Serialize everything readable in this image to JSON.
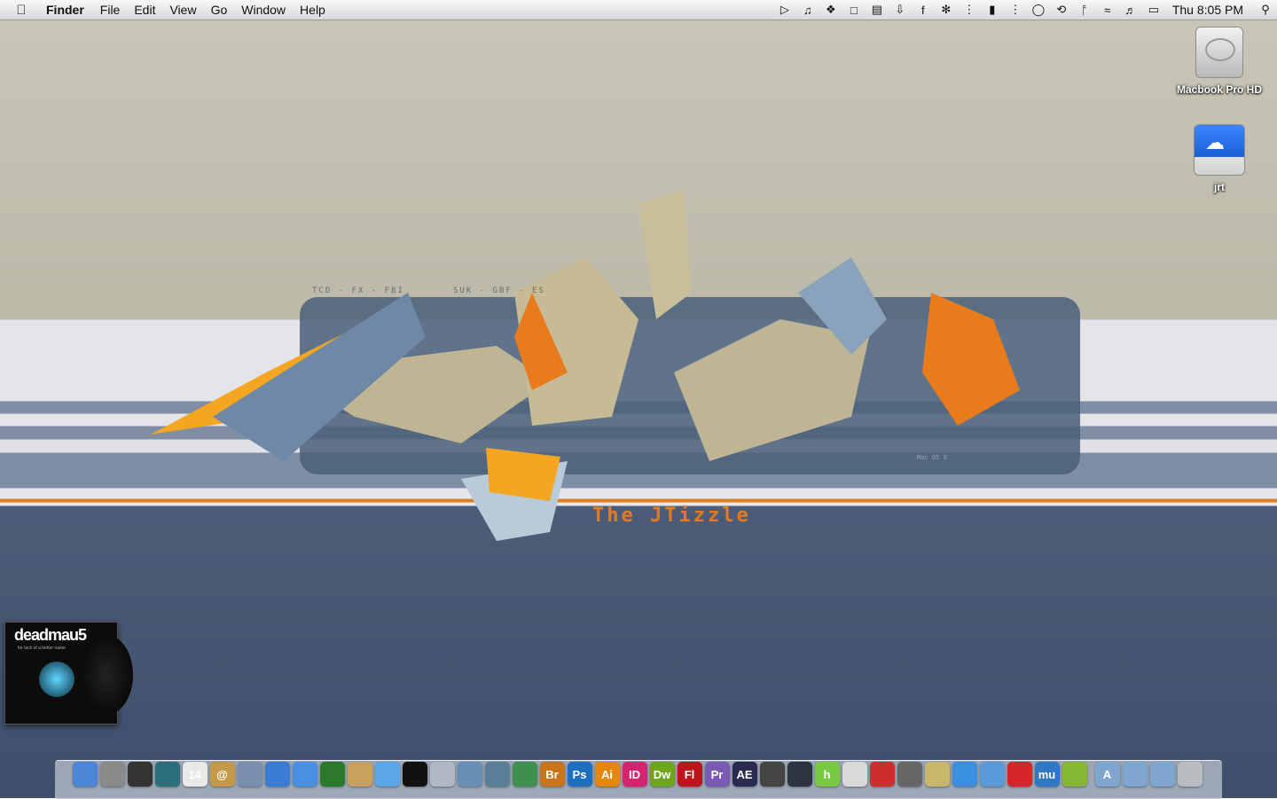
{
  "menubar": {
    "apple": "",
    "app_name": "Finder",
    "menus": [
      "File",
      "Edit",
      "View",
      "Go",
      "Window",
      "Help"
    ],
    "status_icons": [
      "play-icon",
      "music-note-icon",
      "bird-icon",
      "screen-capture-icon",
      "notes-icon",
      "download-icon",
      "facebook-icon",
      "fan-icon",
      "temp-icon",
      "memory-icon",
      "cpu-icon",
      "chat-icon",
      "time-machine-icon",
      "bluetooth-icon",
      "wifi-icon",
      "volume-icon",
      "battery-icon"
    ],
    "clock": "Thu 8:05 PM"
  },
  "desktop_icons": [
    {
      "label": "Macbook Pro HD",
      "icon": "hard-drive-icon"
    },
    {
      "label": "jrt",
      "icon": "icloud-drive-icon"
    }
  ],
  "wallpaper": {
    "tag_left": "TCD - FX - FBI",
    "tag_right": "SUK - GBF - ES",
    "os_label": "Mac OS X",
    "signature": "The JTizzle"
  },
  "album": {
    "artist": "deadmau5",
    "subtitle": "for lack of a better name"
  },
  "dock": {
    "apps": [
      {
        "name": "finder",
        "text": "",
        "color": "#4b86d8"
      },
      {
        "name": "system-preferences",
        "text": "",
        "color": "#8a8a8a"
      },
      {
        "name": "dashboard",
        "text": "",
        "color": "#333333"
      },
      {
        "name": "time-machine",
        "text": "",
        "color": "#2c6e7a"
      },
      {
        "name": "calendar",
        "text": "14",
        "color": "#e9e9e9"
      },
      {
        "name": "address-book",
        "text": "@",
        "color": "#c49a4a"
      },
      {
        "name": "preview",
        "text": "",
        "color": "#7a8fb0"
      },
      {
        "name": "safari",
        "text": "",
        "color": "#3a7bd5"
      },
      {
        "name": "ichat",
        "text": "",
        "color": "#4a90e2"
      },
      {
        "name": "limewire",
        "text": "",
        "color": "#2b7a2b"
      },
      {
        "name": "photo-app",
        "text": "",
        "color": "#c8a060"
      },
      {
        "name": "itunes",
        "text": "",
        "color": "#5aa6e6"
      },
      {
        "name": "dvd-player",
        "text": "",
        "color": "#111111"
      },
      {
        "name": "satellite-app",
        "text": "",
        "color": "#b0b8c4"
      },
      {
        "name": "iphoto",
        "text": "",
        "color": "#6a8fb6"
      },
      {
        "name": "paint-app",
        "text": "",
        "color": "#5a7f9a"
      },
      {
        "name": "chart-app",
        "text": "",
        "color": "#3f8f4f"
      },
      {
        "name": "bridge",
        "text": "Br",
        "color": "#c8741c"
      },
      {
        "name": "photoshop",
        "text": "Ps",
        "color": "#1f6fc0"
      },
      {
        "name": "illustrator",
        "text": "Ai",
        "color": "#e5860d"
      },
      {
        "name": "indesign",
        "text": "ID",
        "color": "#d6236d"
      },
      {
        "name": "dreamweaver",
        "text": "Dw",
        "color": "#6da51c"
      },
      {
        "name": "flash",
        "text": "Fl",
        "color": "#c0141c"
      },
      {
        "name": "premiere",
        "text": "Pr",
        "color": "#7a5ab5"
      },
      {
        "name": "after-effects",
        "text": "AE",
        "color": "#2b2b52"
      },
      {
        "name": "quill-app",
        "text": "",
        "color": "#444444"
      },
      {
        "name": "dolphin-app",
        "text": "",
        "color": "#2a3540"
      },
      {
        "name": "houdini-app",
        "text": "h",
        "color": "#7ac943"
      },
      {
        "name": "ipod-app",
        "text": "",
        "color": "#d9d9d9"
      },
      {
        "name": "transmission",
        "text": "",
        "color": "#cc2d2d"
      },
      {
        "name": "disc-burner",
        "text": "",
        "color": "#666666"
      },
      {
        "name": "disk-utility",
        "text": "",
        "color": "#c9b66a"
      },
      {
        "name": "app-store",
        "text": "",
        "color": "#3b8fe0"
      },
      {
        "name": "xcode",
        "text": "",
        "color": "#5b9ad9"
      },
      {
        "name": "magnet-app",
        "text": "",
        "color": "#d4262b"
      },
      {
        "name": "mu-app",
        "text": "mu",
        "color": "#2f78c2"
      },
      {
        "name": "dropzone-app",
        "text": "",
        "color": "#86b833"
      }
    ],
    "folders": [
      {
        "name": "applications-folder",
        "text": "A",
        "color": "#7fa6cf"
      },
      {
        "name": "documents-folder",
        "text": "",
        "color": "#7fa6cf"
      },
      {
        "name": "downloads-folder",
        "text": "",
        "color": "#7fa6cf"
      },
      {
        "name": "trash",
        "text": "",
        "color": "#b9bcc1"
      }
    ]
  }
}
